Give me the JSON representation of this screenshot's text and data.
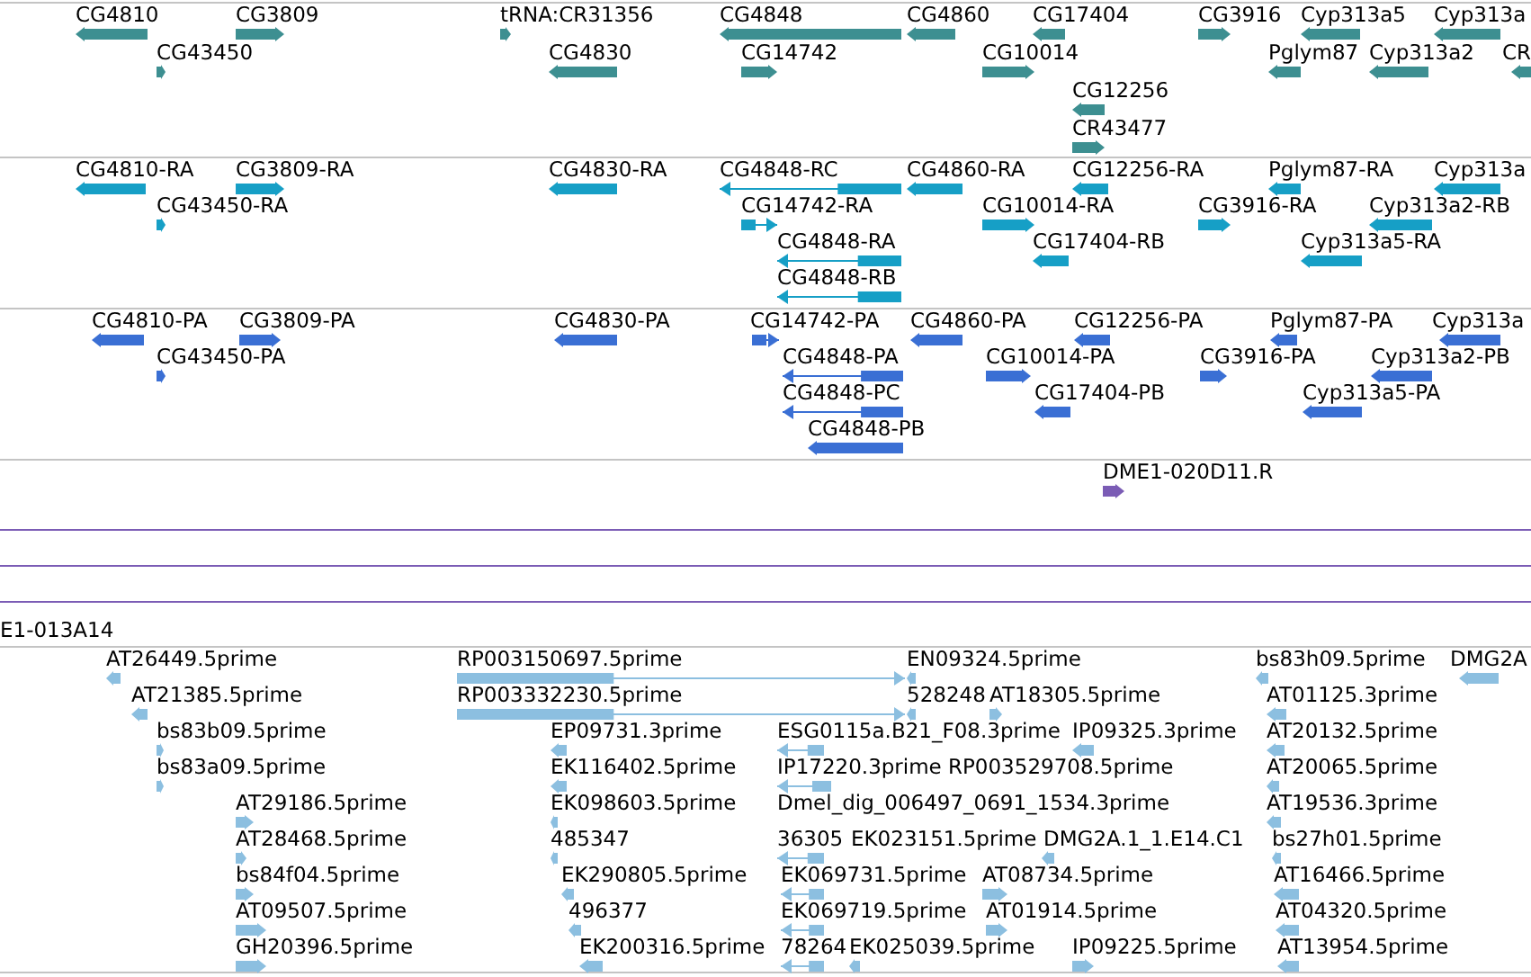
{
  "tracks": [
    {
      "kind": "gene",
      "features": [
        {
          "label": "CG4810",
          "reverse": true
        },
        {
          "label": "CG3809",
          "reverse": false
        },
        {
          "label": "tRNA:CR31356",
          "reverse": false
        },
        {
          "label": "CG4848",
          "reverse": true
        },
        {
          "label": "CG4860",
          "reverse": true
        },
        {
          "label": "CG17404",
          "reverse": true
        },
        {
          "label": "CG3916",
          "reverse": false
        },
        {
          "label": "Cyp313a5",
          "reverse": true
        },
        {
          "label": "Cyp313a",
          "reverse": true
        },
        {
          "label": "CG43450",
          "reverse": false
        },
        {
          "label": "CG4830",
          "reverse": true
        },
        {
          "label": "CG14742",
          "reverse": false
        },
        {
          "label": "CG10014",
          "reverse": false
        },
        {
          "label": "Pglym87",
          "reverse": true
        },
        {
          "label": "Cyp313a2",
          "reverse": true
        },
        {
          "label": "CR",
          "reverse": true
        },
        {
          "label": "CG12256",
          "reverse": true
        },
        {
          "label": "CR43477",
          "reverse": false
        }
      ]
    },
    {
      "kind": "transcript",
      "features": [
        {
          "label": "CG4810-RA",
          "reverse": true
        },
        {
          "label": "CG3809-RA",
          "reverse": false
        },
        {
          "label": "CG4830-RA",
          "reverse": true
        },
        {
          "label": "CG4848-RC",
          "reverse": true
        },
        {
          "label": "CG4860-RA",
          "reverse": true
        },
        {
          "label": "CG12256-RA",
          "reverse": true
        },
        {
          "label": "Pglym87-RA",
          "reverse": true
        },
        {
          "label": "Cyp313a",
          "reverse": true
        },
        {
          "label": "CG43450-RA",
          "reverse": false
        },
        {
          "label": "CG14742-RA",
          "reverse": false
        },
        {
          "label": "CG10014-RA",
          "reverse": false
        },
        {
          "label": "CG3916-RA",
          "reverse": false
        },
        {
          "label": "Cyp313a2-RB",
          "reverse": true
        },
        {
          "label": "CG4848-RA",
          "reverse": true
        },
        {
          "label": "CG17404-RB",
          "reverse": true
        },
        {
          "label": "Cyp313a5-RA",
          "reverse": true
        },
        {
          "label": "CG4848-RB",
          "reverse": true
        }
      ]
    },
    {
      "kind": "protein",
      "features": [
        {
          "label": "CG4810-PA",
          "reverse": true
        },
        {
          "label": "CG3809-PA",
          "reverse": false
        },
        {
          "label": "CG4830-PA",
          "reverse": true
        },
        {
          "label": "CG14742-PA",
          "reverse": false
        },
        {
          "label": "CG4860-PA",
          "reverse": true
        },
        {
          "label": "CG12256-PA",
          "reverse": true
        },
        {
          "label": "Pglym87-PA",
          "reverse": true
        },
        {
          "label": "Cyp313a",
          "reverse": true
        },
        {
          "label": "CG43450-PA",
          "reverse": false
        },
        {
          "label": "CG4848-PA",
          "reverse": true
        },
        {
          "label": "CG10014-PA",
          "reverse": false
        },
        {
          "label": "CG3916-PA",
          "reverse": false
        },
        {
          "label": "Cyp313a2-PB",
          "reverse": true
        },
        {
          "label": "CG4848-PC",
          "reverse": true
        },
        {
          "label": "CG17404-PB",
          "reverse": true
        },
        {
          "label": "Cyp313a5-PA",
          "reverse": true
        },
        {
          "label": "CG4848-PB",
          "reverse": true
        }
      ]
    },
    {
      "kind": "clone",
      "features": [
        {
          "label": "DME1-020D11.R",
          "reverse": false
        },
        {
          "kind": "span"
        },
        {
          "kind": "span"
        },
        {
          "kind": "span"
        },
        {
          "label": "E1-013A14"
        }
      ]
    },
    {
      "kind": "est",
      "features": [
        {
          "label": "AT26449.5prime",
          "reverse": true
        },
        {
          "label": "RP003150697.5prime",
          "reverse": false
        },
        {
          "label": "EN09324.5prime",
          "reverse": true
        },
        {
          "label": "bs83h09.5prime",
          "reverse": true
        },
        {
          "label": "DMG2A",
          "reverse": true
        },
        {
          "label": "AT21385.5prime",
          "reverse": true
        },
        {
          "label": "RP003332230.5prime",
          "reverse": false
        },
        {
          "label": "528248",
          "reverse": true
        },
        {
          "label": "AT18305.5prime",
          "reverse": false
        },
        {
          "label": "AT01125.3prime",
          "reverse": true
        },
        {
          "label": "bs83b09.5prime",
          "reverse": false
        },
        {
          "label": "EP09731.3prime",
          "reverse": true
        },
        {
          "label": "ESG0115a.B21_F08.3prime",
          "reverse": true
        },
        {
          "label": "IP09325.3prime",
          "reverse": true
        },
        {
          "label": "AT20132.5prime",
          "reverse": true
        },
        {
          "label": "bs83a09.5prime",
          "reverse": false
        },
        {
          "label": "EK116402.5prime",
          "reverse": true
        },
        {
          "label": "IP17220.3prime",
          "reverse": true
        },
        {
          "label": "RP003529708.5prime"
        },
        {
          "label": "AT20065.5prime",
          "reverse": true
        },
        {
          "label": "AT29186.5prime",
          "reverse": false
        },
        {
          "label": "EK098603.5prime",
          "reverse": true
        },
        {
          "label": "Dmel_dig_006497_0691_1534.3prime"
        },
        {
          "label": "AT19536.3prime",
          "reverse": true
        },
        {
          "label": "AT28468.5prime",
          "reverse": false
        },
        {
          "label": "485347",
          "reverse": true
        },
        {
          "label": "36305",
          "reverse": true
        },
        {
          "label": "EK023151.5prime"
        },
        {
          "label": "DMG2A.1_1.E14.C1",
          "reverse": true
        },
        {
          "label": "bs27h01.5prime",
          "reverse": true
        },
        {
          "label": "bs84f04.5prime",
          "reverse": false
        },
        {
          "label": "EK290805.5prime",
          "reverse": true
        },
        {
          "label": "EK069731.5prime",
          "reverse": true
        },
        {
          "label": "AT08734.5prime",
          "reverse": false
        },
        {
          "label": "AT16466.5prime",
          "reverse": true
        },
        {
          "label": "AT09507.5prime",
          "reverse": false
        },
        {
          "label": "496377",
          "reverse": true
        },
        {
          "label": "EK069719.5prime",
          "reverse": true
        },
        {
          "label": "AT01914.5prime",
          "reverse": false
        },
        {
          "label": "AT04320.5prime",
          "reverse": true
        },
        {
          "label": "GH20396.5prime",
          "reverse": false
        },
        {
          "label": "EK200316.5prime",
          "reverse": true
        },
        {
          "label": "78264",
          "reverse": true
        },
        {
          "label": "EK025039.5prime",
          "reverse": true
        },
        {
          "label": "IP09225.5prime",
          "reverse": false
        },
        {
          "label": "AT13954.5prime",
          "reverse": true
        }
      ]
    }
  ]
}
